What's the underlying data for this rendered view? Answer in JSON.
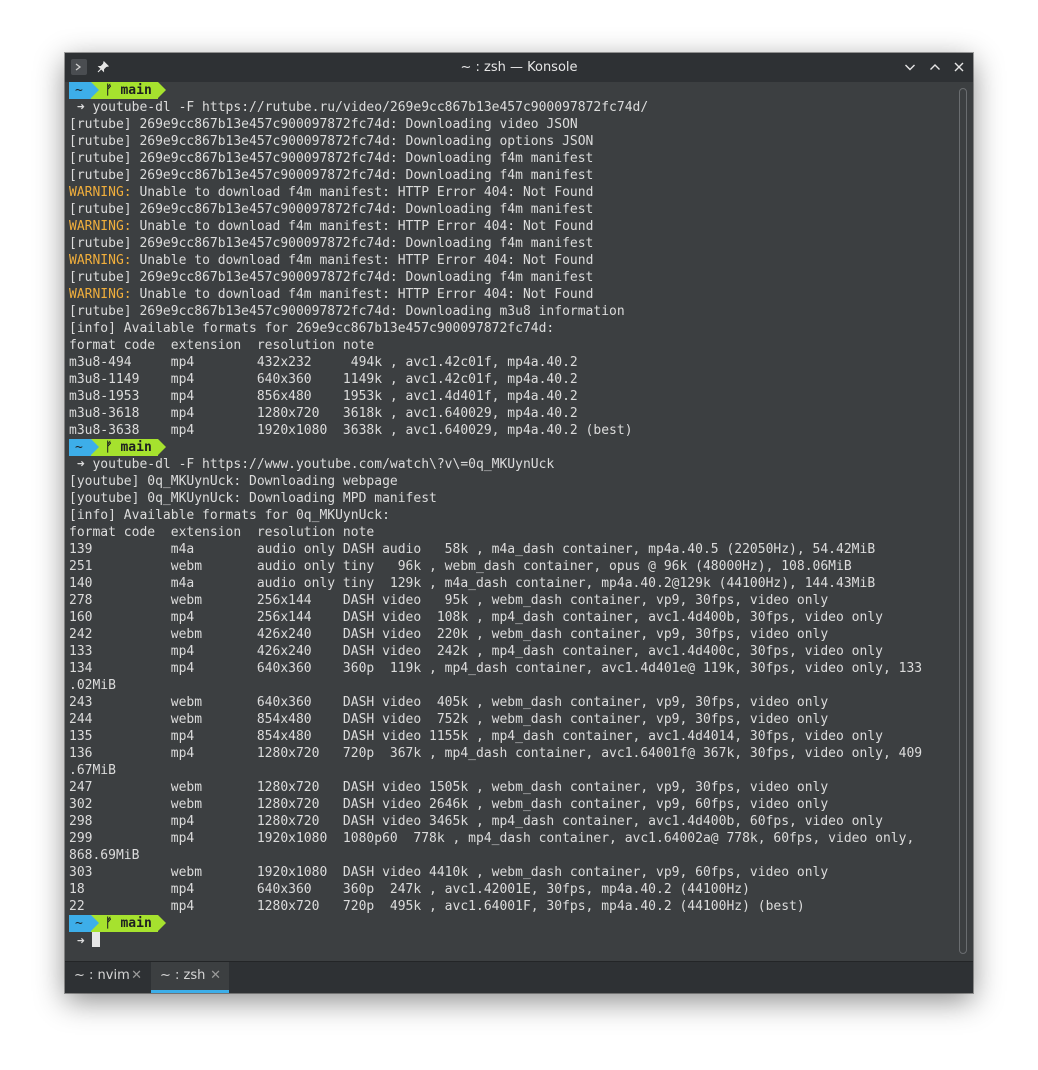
{
  "window": {
    "title": "~ : zsh — Konsole"
  },
  "prompt": {
    "home": "~",
    "branch_glyph": "ᚠ",
    "branch": "main",
    "arrow": "➜"
  },
  "terminal": {
    "lines": [
      {
        "type": "prompt"
      },
      {
        "type": "cmd",
        "text": "youtube-dl -F https://rutube.ru/video/269e9cc867b13e457c900097872fc74d/"
      },
      {
        "type": "text",
        "text": "[rutube] 269e9cc867b13e457c900097872fc74d: Downloading video JSON"
      },
      {
        "type": "text",
        "text": "[rutube] 269e9cc867b13e457c900097872fc74d: Downloading options JSON"
      },
      {
        "type": "text",
        "text": "[rutube] 269e9cc867b13e457c900097872fc74d: Downloading f4m manifest"
      },
      {
        "type": "text",
        "text": "[rutube] 269e9cc867b13e457c900097872fc74d: Downloading f4m manifest"
      },
      {
        "type": "warn",
        "label": "WARNING:",
        "text": " Unable to download f4m manifest: HTTP Error 404: Not Found"
      },
      {
        "type": "text",
        "text": "[rutube] 269e9cc867b13e457c900097872fc74d: Downloading f4m manifest"
      },
      {
        "type": "warn",
        "label": "WARNING:",
        "text": " Unable to download f4m manifest: HTTP Error 404: Not Found"
      },
      {
        "type": "text",
        "text": "[rutube] 269e9cc867b13e457c900097872fc74d: Downloading f4m manifest"
      },
      {
        "type": "warn",
        "label": "WARNING:",
        "text": " Unable to download f4m manifest: HTTP Error 404: Not Found"
      },
      {
        "type": "text",
        "text": "[rutube] 269e9cc867b13e457c900097872fc74d: Downloading f4m manifest"
      },
      {
        "type": "warn",
        "label": "WARNING:",
        "text": " Unable to download f4m manifest: HTTP Error 404: Not Found"
      },
      {
        "type": "text",
        "text": "[rutube] 269e9cc867b13e457c900097872fc74d: Downloading m3u8 information"
      },
      {
        "type": "text",
        "text": "[info] Available formats for 269e9cc867b13e457c900097872fc74d:"
      },
      {
        "type": "text",
        "text": "format code  extension  resolution note"
      },
      {
        "type": "text",
        "text": "m3u8-494     mp4        432x232     494k , avc1.42c01f, mp4a.40.2"
      },
      {
        "type": "text",
        "text": "m3u8-1149    mp4        640x360    1149k , avc1.42c01f, mp4a.40.2"
      },
      {
        "type": "text",
        "text": "m3u8-1953    mp4        856x480    1953k , avc1.4d401f, mp4a.40.2"
      },
      {
        "type": "text",
        "text": "m3u8-3618    mp4        1280x720   3618k , avc1.640029, mp4a.40.2"
      },
      {
        "type": "text",
        "text": "m3u8-3638    mp4        1920x1080  3638k , avc1.640029, mp4a.40.2 (best)"
      },
      {
        "type": "prompt"
      },
      {
        "type": "cmd",
        "text": "youtube-dl -F https://www.youtube.com/watch\\?v\\=0q_MKUynUck"
      },
      {
        "type": "text",
        "text": "[youtube] 0q_MKUynUck: Downloading webpage"
      },
      {
        "type": "text",
        "text": "[youtube] 0q_MKUynUck: Downloading MPD manifest"
      },
      {
        "type": "text",
        "text": "[info] Available formats for 0q_MKUynUck:"
      },
      {
        "type": "text",
        "text": "format code  extension  resolution note"
      },
      {
        "type": "text",
        "text": "139          m4a        audio only DASH audio   58k , m4a_dash container, mp4a.40.5 (22050Hz), 54.42MiB"
      },
      {
        "type": "text",
        "text": "251          webm       audio only tiny   96k , webm_dash container, opus @ 96k (48000Hz), 108.06MiB"
      },
      {
        "type": "text",
        "text": "140          m4a        audio only tiny  129k , m4a_dash container, mp4a.40.2@129k (44100Hz), 144.43MiB"
      },
      {
        "type": "text",
        "text": "278          webm       256x144    DASH video   95k , webm_dash container, vp9, 30fps, video only"
      },
      {
        "type": "text",
        "text": "160          mp4        256x144    DASH video  108k , mp4_dash container, avc1.4d400b, 30fps, video only"
      },
      {
        "type": "text",
        "text": "242          webm       426x240    DASH video  220k , webm_dash container, vp9, 30fps, video only"
      },
      {
        "type": "text",
        "text": "133          mp4        426x240    DASH video  242k , mp4_dash container, avc1.4d400c, 30fps, video only"
      },
      {
        "type": "text",
        "text": "134          mp4        640x360    360p  119k , mp4_dash container, avc1.4d401e@ 119k, 30fps, video only, 133"
      },
      {
        "type": "text",
        "text": ".02MiB"
      },
      {
        "type": "text",
        "text": "243          webm       640x360    DASH video  405k , webm_dash container, vp9, 30fps, video only"
      },
      {
        "type": "text",
        "text": "244          webm       854x480    DASH video  752k , webm_dash container, vp9, 30fps, video only"
      },
      {
        "type": "text",
        "text": "135          mp4        854x480    DASH video 1155k , mp4_dash container, avc1.4d4014, 30fps, video only"
      },
      {
        "type": "text",
        "text": "136          mp4        1280x720   720p  367k , mp4_dash container, avc1.64001f@ 367k, 30fps, video only, 409"
      },
      {
        "type": "text",
        "text": ".67MiB"
      },
      {
        "type": "text",
        "text": "247          webm       1280x720   DASH video 1505k , webm_dash container, vp9, 30fps, video only"
      },
      {
        "type": "text",
        "text": "302          webm       1280x720   DASH video 2646k , webm_dash container, vp9, 60fps, video only"
      },
      {
        "type": "text",
        "text": "298          mp4        1280x720   DASH video 3465k , mp4_dash container, avc1.4d400b, 60fps, video only"
      },
      {
        "type": "text",
        "text": "299          mp4        1920x1080  1080p60  778k , mp4_dash container, avc1.64002a@ 778k, 60fps, video only,"
      },
      {
        "type": "text",
        "text": "868.69MiB"
      },
      {
        "type": "text",
        "text": "303          webm       1920x1080  DASH video 4410k , webm_dash container, vp9, 60fps, video only"
      },
      {
        "type": "text",
        "text": "18           mp4        640x360    360p  247k , avc1.42001E, 30fps, mp4a.40.2 (44100Hz)"
      },
      {
        "type": "text",
        "text": "22           mp4        1280x720   720p  495k , avc1.64001F, 30fps, mp4a.40.2 (44100Hz) (best)"
      },
      {
        "type": "prompt"
      },
      {
        "type": "input",
        "text": ""
      }
    ]
  },
  "tabs": [
    {
      "label": "~ : nvim",
      "close": "✕",
      "active": false
    },
    {
      "label": "~ : zsh",
      "close": "✕",
      "active": true
    }
  ],
  "colors": {
    "background": "#3c3f41",
    "text": "#dcdcdc",
    "warning": "#f0ae3c",
    "accent": "#3daee9",
    "branch": "#a6e22e"
  }
}
